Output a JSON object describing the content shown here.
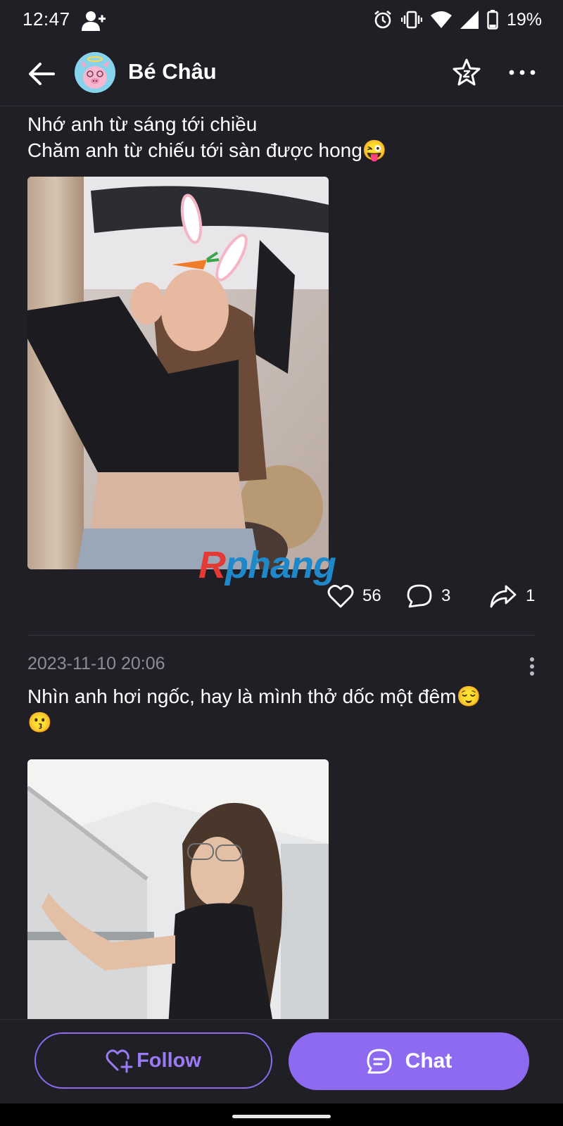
{
  "status_bar": {
    "time": "12:47",
    "battery": "19%",
    "icons": [
      "person-add-icon",
      "alarm-icon",
      "vibrate-icon",
      "wifi-icon",
      "signal-icon",
      "battery-icon"
    ]
  },
  "header": {
    "title": "Bé Châu",
    "icons": [
      "back-arrow-icon",
      "avatar",
      "star-icon",
      "more-icon"
    ]
  },
  "posts": [
    {
      "text": "Nhớ anh từ sáng tới chiều\nChăm anh từ chiếu tới sàn được hong😜",
      "watermark_part1": "R",
      "watermark_part2": "phang",
      "likes": "56",
      "comments": "3",
      "shares": "1"
    },
    {
      "date": "2023-11-10 20:06",
      "text": "Nhìn anh hơi ngốc, hay là mình thở dốc một đêm😌\n😗"
    }
  ],
  "bottom_bar": {
    "follow_label": "Follow",
    "chat_label": "Chat"
  },
  "colors": {
    "background": "#211f26",
    "accent": "#8e6af0",
    "muted_text": "#8e8b97"
  }
}
